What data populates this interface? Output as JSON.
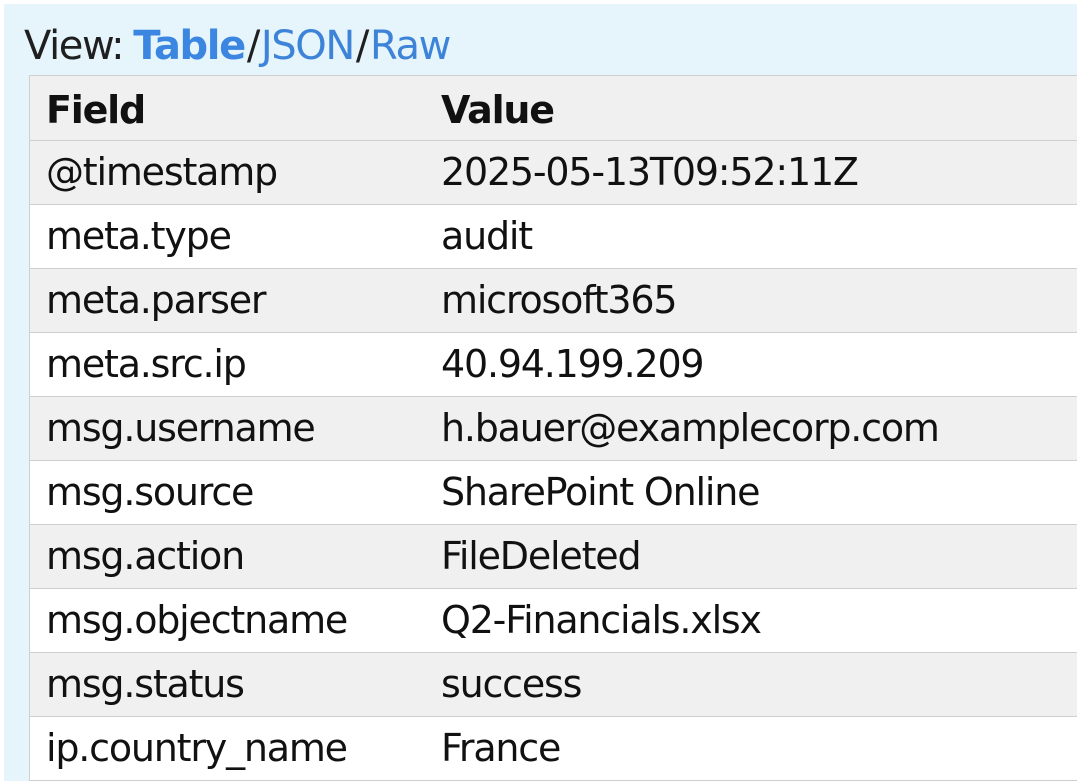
{
  "view_bar": {
    "prefix": "View:",
    "options": [
      "Table",
      "JSON",
      "Raw"
    ],
    "separator": "/",
    "active": "Table"
  },
  "table": {
    "headers": {
      "field": "Field",
      "value": "Value"
    },
    "rows": [
      {
        "field": "@timestamp",
        "value": "2025-05-13T09:52:11Z"
      },
      {
        "field": "meta.type",
        "value": "audit"
      },
      {
        "field": "meta.parser",
        "value": "microsoft365"
      },
      {
        "field": "meta.src.ip",
        "value": "40.94.199.209"
      },
      {
        "field": "msg.username",
        "value": "h.bauer@examplecorp.com"
      },
      {
        "field": "msg.source",
        "value": "SharePoint Online"
      },
      {
        "field": "msg.action",
        "value": "FileDeleted"
      },
      {
        "field": "msg.objectname",
        "value": "Q2-Financials.xlsx"
      },
      {
        "field": "msg.status",
        "value": "success"
      },
      {
        "field": "ip.country_name",
        "value": "France"
      }
    ]
  },
  "colors": {
    "panel_bg": "#e6f4fc",
    "link": "#3d84d8",
    "row_alt": "#f0f0f0"
  }
}
